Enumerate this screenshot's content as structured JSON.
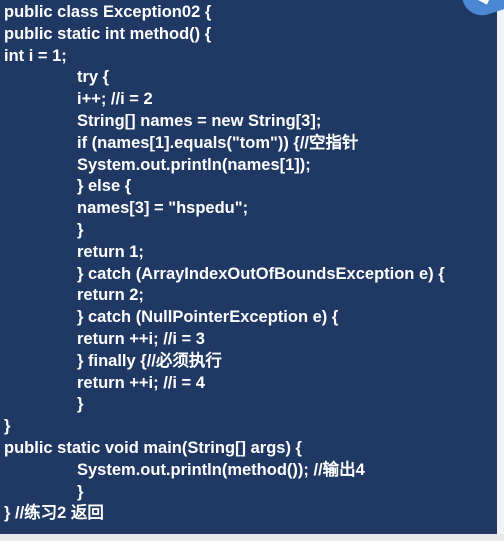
{
  "code_lines": [
    {
      "indent": 0,
      "text": "public class Exception02 {"
    },
    {
      "indent": 0,
      "text": "public static int method() {"
    },
    {
      "indent": 0,
      "text": "int i = 1;"
    },
    {
      "indent": 1,
      "text": "try {"
    },
    {
      "indent": 1,
      "text": "i++; //i = 2"
    },
    {
      "indent": 1,
      "text": "String[] names = new String[3];"
    },
    {
      "indent": 1,
      "text": "if (names[1].equals(\"tom\")) {//空指针"
    },
    {
      "indent": 1,
      "text": "System.out.println(names[1]);"
    },
    {
      "indent": 1,
      "text": "} else {"
    },
    {
      "indent": 1,
      "text": "names[3] = \"hspedu\";"
    },
    {
      "indent": 1,
      "text": "}"
    },
    {
      "indent": 1,
      "text": "return 1;"
    },
    {
      "indent": 1,
      "text": "} catch (ArrayIndexOutOfBoundsException e) {"
    },
    {
      "indent": 1,
      "text": "return 2;"
    },
    {
      "indent": 1,
      "text": "} catch (NullPointerException e) {"
    },
    {
      "indent": 1,
      "text": "return ++i; //i = 3"
    },
    {
      "indent": 1,
      "text": "} finally {//必须执行"
    },
    {
      "indent": 1,
      "text": "return ++i; //i = 4"
    },
    {
      "indent": 1,
      "text": "}"
    },
    {
      "indent": 0,
      "text": "}"
    },
    {
      "indent": 0,
      "text": "public static void main(String[] args) {"
    },
    {
      "indent": 1,
      "text": "System.out.println(method()); //输出4"
    },
    {
      "indent": 1,
      "text": "}"
    },
    {
      "indent": 0,
      "text": "} //练习2 返回"
    }
  ],
  "colors": {
    "slide_background": "#1f3864",
    "code_text": "#ffffff",
    "badge": "#4a88d4"
  },
  "icons": {
    "corner": "checkmark-badge-icon"
  }
}
